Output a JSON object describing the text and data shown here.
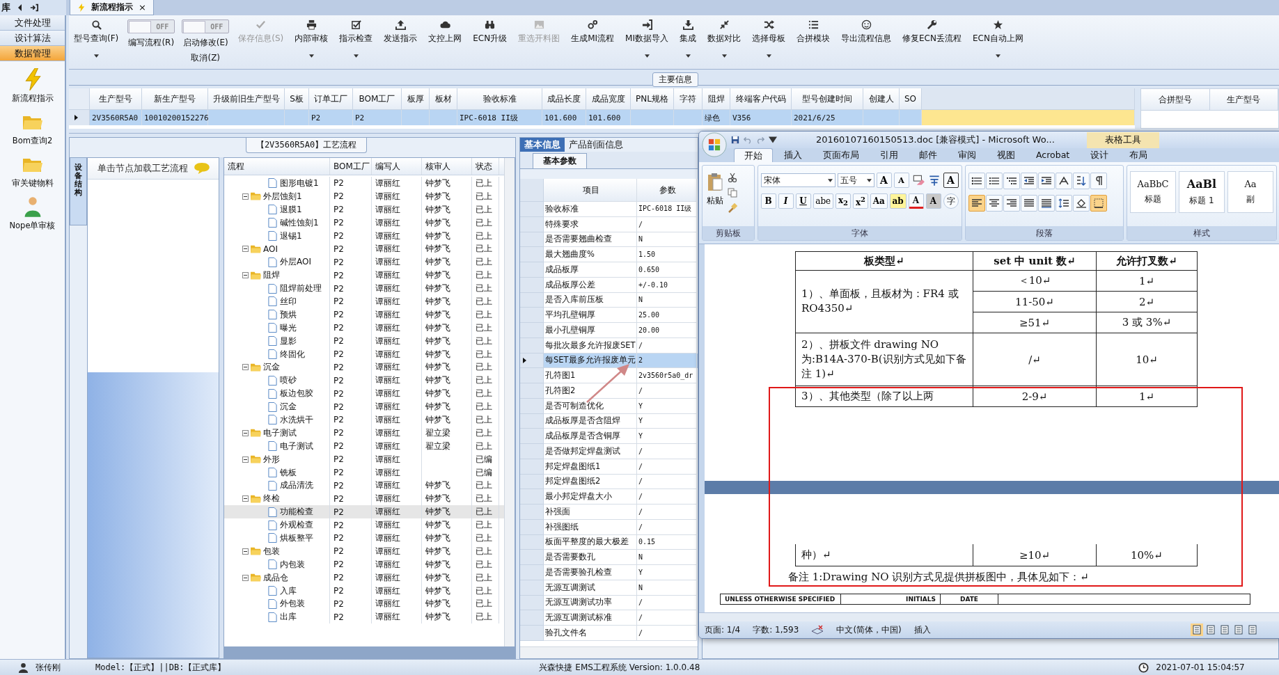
{
  "app_tabs": {
    "module_label": "库",
    "tab": {
      "title": "新流程指示",
      "close": "×"
    }
  },
  "sidebar": {
    "sections": [
      {
        "label": "文件处理",
        "selected": false
      },
      {
        "label": "设计算法",
        "selected": false
      },
      {
        "label": "数据管理",
        "selected": true
      }
    ],
    "items": [
      {
        "label": "新流程指示"
      },
      {
        "label": "Bom查询2"
      },
      {
        "label": "审关键物料"
      },
      {
        "label": "Nope单审核"
      }
    ]
  },
  "toolbar": [
    {
      "kind": "button",
      "label": "型号查询(F)",
      "dropdown": true,
      "disabled": false
    },
    {
      "kind": "toggle",
      "label": "编写流程(R)",
      "switch": "OFF",
      "on": false
    },
    {
      "kind": "toggle",
      "label": "启动修改(E)",
      "sublabel": "取消(Z)",
      "switch": "OFF",
      "on": false
    },
    {
      "kind": "button",
      "label": "保存信息(S)",
      "dropdown": false,
      "disabled": true
    },
    {
      "kind": "button",
      "label": "内部审核",
      "dropdown": true,
      "disabled": false
    },
    {
      "kind": "button",
      "label": "指示检查",
      "dropdown": true,
      "disabled": false
    },
    {
      "kind": "button",
      "label": "发送指示",
      "dropdown": false,
      "disabled": false
    },
    {
      "kind": "button",
      "label": "文控上网",
      "dropdown": false,
      "disabled": false
    },
    {
      "kind": "button",
      "label": "ECN升级",
      "dropdown": false,
      "disabled": false
    },
    {
      "kind": "button",
      "label": "重选开料图",
      "dropdown": false,
      "disabled": true
    },
    {
      "kind": "button",
      "label": "生成MI流程",
      "dropdown": false,
      "disabled": false
    },
    {
      "kind": "button",
      "label": "MI数据导入",
      "dropdown": true,
      "disabled": false
    },
    {
      "kind": "button",
      "label": "集成",
      "dropdown": true,
      "disabled": false
    },
    {
      "kind": "button",
      "label": "数据对比",
      "dropdown": true,
      "disabled": false
    },
    {
      "kind": "button",
      "label": "选择母板",
      "dropdown": true,
      "disabled": false
    },
    {
      "kind": "button",
      "label": "合拼模块",
      "dropdown": false,
      "disabled": false
    },
    {
      "kind": "button",
      "label": "导出流程信息",
      "dropdown": false,
      "disabled": false
    },
    {
      "kind": "button",
      "label": "修复ECN丢流程",
      "dropdown": false,
      "disabled": false
    },
    {
      "kind": "button",
      "label": "ECN自动上网",
      "dropdown": true,
      "disabled": false
    }
  ],
  "main_info": {
    "title": "主要信息",
    "columns": [
      "生产型号",
      "新生产型号",
      "升级前旧生产型号",
      "S板",
      "订单工厂",
      "BOM工厂",
      "板厚",
      "板材",
      "验收标准",
      "成品长度",
      "成品宽度",
      "PNL规格",
      "字符",
      "阻焊",
      "终端客户代码",
      "型号创建时间",
      "创建人",
      "SO"
    ],
    "rows": [
      {
        "selected": true,
        "cells": [
          "2V3560R5A0",
          "10010200152276",
          null,
          null,
          "P2",
          "P2",
          null,
          null,
          "IPC-6018 II级",
          "101.600",
          "101.600",
          null,
          null,
          "绿色",
          "V356",
          "2021/6/25",
          null,
          null
        ]
      }
    ],
    "merge_table": {
      "columns": [
        "合拼型号",
        "生产型号"
      ]
    }
  },
  "process_panel": {
    "title": "【2V3560R5A0】工艺流程",
    "side_tab": "设备结构",
    "hint": "单击节点加载工艺流程",
    "columns": [
      "流程",
      "BOM工厂",
      "编写人",
      "核审人",
      "状态"
    ],
    "tree": [
      {
        "kind": "file",
        "name": "图形电镀1",
        "bom": "P2",
        "writer": "谭丽红",
        "reviewer": "钟梦飞",
        "status": "已上",
        "selected": false
      },
      {
        "kind": "folder",
        "name": "外层蚀刻1",
        "expanded": true,
        "bom": "P2",
        "writer": "谭丽红",
        "reviewer": "钟梦飞",
        "status": "已上",
        "selected": false,
        "children": [
          {
            "kind": "file",
            "name": "退膜1",
            "bom": "P2",
            "writer": "谭丽红",
            "reviewer": "钟梦飞",
            "status": "已上",
            "selected": false
          },
          {
            "kind": "file",
            "name": "碱性蚀刻1",
            "bom": "P2",
            "writer": "谭丽红",
            "reviewer": "钟梦飞",
            "status": "已上",
            "selected": false
          },
          {
            "kind": "file",
            "name": "退锡1",
            "bom": "P2",
            "writer": "谭丽红",
            "reviewer": "钟梦飞",
            "status": "已上",
            "selected": false
          }
        ]
      },
      {
        "kind": "folder",
        "name": "AOI",
        "expanded": true,
        "bom": "P2",
        "writer": "谭丽红",
        "reviewer": "钟梦飞",
        "status": "已上",
        "selected": false,
        "children": [
          {
            "kind": "file",
            "name": "外层AOI",
            "bom": "P2",
            "writer": "谭丽红",
            "reviewer": "钟梦飞",
            "status": "已上",
            "selected": false
          }
        ]
      },
      {
        "kind": "folder",
        "name": "阻焊",
        "expanded": true,
        "bom": "P2",
        "writer": "谭丽红",
        "reviewer": "钟梦飞",
        "status": "已上",
        "selected": false,
        "children": [
          {
            "kind": "file",
            "name": "阻焊前处理",
            "bom": "P2",
            "writer": "谭丽红",
            "reviewer": "钟梦飞",
            "status": "已上",
            "selected": false
          },
          {
            "kind": "file",
            "name": "丝印",
            "bom": "P2",
            "writer": "谭丽红",
            "reviewer": "钟梦飞",
            "status": "已上",
            "selected": false
          },
          {
            "kind": "file",
            "name": "预烘",
            "bom": "P2",
            "writer": "谭丽红",
            "reviewer": "钟梦飞",
            "status": "已上",
            "selected": false
          },
          {
            "kind": "file",
            "name": "曝光",
            "bom": "P2",
            "writer": "谭丽红",
            "reviewer": "钟梦飞",
            "status": "已上",
            "selected": false
          },
          {
            "kind": "file",
            "name": "显影",
            "bom": "P2",
            "writer": "谭丽红",
            "reviewer": "钟梦飞",
            "status": "已上",
            "selected": false
          },
          {
            "kind": "file",
            "name": "终固化",
            "bom": "P2",
            "writer": "谭丽红",
            "reviewer": "钟梦飞",
            "status": "已上",
            "selected": false
          }
        ]
      },
      {
        "kind": "folder",
        "name": "沉金",
        "expanded": true,
        "bom": "P2",
        "writer": "谭丽红",
        "reviewer": "钟梦飞",
        "status": "已上",
        "selected": false,
        "children": [
          {
            "kind": "file",
            "name": "喷砂",
            "bom": "P2",
            "writer": "谭丽红",
            "reviewer": "钟梦飞",
            "status": "已上",
            "selected": false
          },
          {
            "kind": "file",
            "name": "板边包胶",
            "bom": "P2",
            "writer": "谭丽红",
            "reviewer": "钟梦飞",
            "status": "已上",
            "selected": false
          },
          {
            "kind": "file",
            "name": "沉金",
            "bom": "P2",
            "writer": "谭丽红",
            "reviewer": "钟梦飞",
            "status": "已上",
            "selected": false
          },
          {
            "kind": "file",
            "name": "水洗烘干",
            "bom": "P2",
            "writer": "谭丽红",
            "reviewer": "钟梦飞",
            "status": "已上",
            "selected": false
          }
        ]
      },
      {
        "kind": "folder",
        "name": "电子测试",
        "expanded": true,
        "bom": "P2",
        "writer": "谭丽红",
        "reviewer": "翟立梁",
        "status": "已上",
        "selected": false,
        "children": [
          {
            "kind": "file",
            "name": "电子测试",
            "bom": "P2",
            "writer": "谭丽红",
            "reviewer": "翟立梁",
            "status": "已上",
            "selected": false
          }
        ]
      },
      {
        "kind": "folder",
        "name": "外形",
        "expanded": true,
        "bom": "P2",
        "writer": "谭丽红",
        "status": "已编",
        "selected": false,
        "children": [
          {
            "kind": "file",
            "name": "铣板",
            "bom": "P2",
            "writer": "谭丽红",
            "status": "已编",
            "selected": false
          },
          {
            "kind": "file",
            "name": "成品清洗",
            "bom": "P2",
            "writer": "谭丽红",
            "reviewer": "钟梦飞",
            "status": "已上",
            "selected": false
          }
        ]
      },
      {
        "kind": "folder",
        "name": "终检",
        "expanded": true,
        "bom": "P2",
        "writer": "谭丽红",
        "reviewer": "钟梦飞",
        "status": "已上",
        "selected": false,
        "children": [
          {
            "kind": "file",
            "name": "功能检查",
            "bom": "P2",
            "writer": "谭丽红",
            "reviewer": "钟梦飞",
            "status": "已上",
            "selected": true
          },
          {
            "kind": "file",
            "name": "外观检查",
            "bom": "P2",
            "writer": "谭丽红",
            "reviewer": "钟梦飞",
            "status": "已上",
            "selected": false
          },
          {
            "kind": "file",
            "name": "烘板整平",
            "bom": "P2",
            "writer": "谭丽红",
            "reviewer": "钟梦飞",
            "status": "已上",
            "selected": false
          }
        ]
      },
      {
        "kind": "folder",
        "name": "包装",
        "expanded": true,
        "bom": "P2",
        "writer": "谭丽红",
        "reviewer": "钟梦飞",
        "status": "已上",
        "selected": false,
        "children": [
          {
            "kind": "file",
            "name": "内包装",
            "bom": "P2",
            "writer": "谭丽红",
            "reviewer": "钟梦飞",
            "status": "已上",
            "selected": false
          }
        ]
      },
      {
        "kind": "folder",
        "name": "成品仓",
        "expanded": true,
        "bom": "P2",
        "writer": "谭丽红",
        "reviewer": "钟梦飞",
        "status": "已上",
        "selected": false,
        "children": [
          {
            "kind": "file",
            "name": "入库",
            "bom": "P2",
            "writer": "谭丽红",
            "reviewer": "钟梦飞",
            "status": "已上",
            "selected": false
          },
          {
            "kind": "file",
            "name": "外包装",
            "bom": "P2",
            "writer": "谭丽红",
            "reviewer": "钟梦飞",
            "status": "已上",
            "selected": false
          },
          {
            "kind": "file",
            "name": "出库",
            "bom": "P2",
            "writer": "谭丽红",
            "reviewer": "钟梦飞",
            "status": "已上",
            "selected": false
          }
        ]
      }
    ]
  },
  "info_panel": {
    "tabs": [
      {
        "label": "基本信息",
        "selected": true
      },
      {
        "label": "产品剖面信息",
        "selected": false
      }
    ],
    "subtab": "基本参数",
    "columns": [
      "项目",
      "参数"
    ],
    "rows": [
      {
        "item": "验收标准",
        "value": "IPC-6018 II级",
        "selected": false
      },
      {
        "item": "特殊要求",
        "value": "/",
        "selected": false
      },
      {
        "item": "是否需要翘曲检查",
        "value": "N",
        "selected": false
      },
      {
        "item": "最大翘曲度%",
        "value": "1.50",
        "selected": false
      },
      {
        "item": "成品板厚",
        "value": "0.650",
        "selected": false
      },
      {
        "item": "成品板厚公差",
        "value": "+/-0.10",
        "selected": false
      },
      {
        "item": "是否入库前压板",
        "value": "N",
        "selected": false
      },
      {
        "item": "平均孔壁铜厚",
        "value": "25.00",
        "selected": false
      },
      {
        "item": "最小孔壁铜厚",
        "value": "20.00",
        "selected": false
      },
      {
        "item": "每批次最多允许报废SET",
        "value": "/",
        "selected": false
      },
      {
        "item": "每SET最多允许报废单元",
        "value": "2",
        "selected": true
      },
      {
        "item": "孔符图1",
        "value": "2v3560r5a0_dr",
        "selected": false
      },
      {
        "item": "孔符图2",
        "value": "/",
        "selected": false
      },
      {
        "item": "是否可制造优化",
        "value": "Y",
        "selected": false
      },
      {
        "item": "成品板厚是否含阻焊",
        "value": "Y",
        "selected": false
      },
      {
        "item": "成品板厚是否含铜厚",
        "value": "Y",
        "selected": false
      },
      {
        "item": "是否做邦定焊盘测试",
        "value": "/",
        "selected": false
      },
      {
        "item": "邦定焊盘图纸1",
        "value": "/",
        "selected": false
      },
      {
        "item": "邦定焊盘图纸2",
        "value": "/",
        "selected": false
      },
      {
        "item": "最小邦定焊盘大小",
        "value": "/",
        "selected": false
      },
      {
        "item": "补强面",
        "value": "/",
        "selected": false
      },
      {
        "item": "补强图纸",
        "value": "/",
        "selected": false
      },
      {
        "item": "板面平整度的最大极差",
        "value": "0.15",
        "selected": false
      },
      {
        "item": "是否需要数孔",
        "value": "N",
        "selected": false
      },
      {
        "item": "是否需要验孔检查",
        "value": "Y",
        "selected": false
      },
      {
        "item": "无源互调测试",
        "value": "N",
        "selected": false
      },
      {
        "item": "无源互调测试功率",
        "value": "/",
        "selected": false
      },
      {
        "item": "无源互调测试标准",
        "value": "/",
        "selected": false
      },
      {
        "item": "验孔文件名",
        "value": "/",
        "selected": false
      }
    ]
  },
  "word_window": {
    "title": "20160107160150513.doc [兼容模式] - Microsoft Wo...",
    "context_tab": "表格工具",
    "tabs": [
      {
        "label": "开始",
        "selected": true
      },
      {
        "label": "插入",
        "selected": false
      },
      {
        "label": "页面布局",
        "selected": false
      },
      {
        "label": "引用",
        "selected": false
      },
      {
        "label": "邮件",
        "selected": false
      },
      {
        "label": "审阅",
        "selected": false
      },
      {
        "label": "视图",
        "selected": false
      },
      {
        "label": "Acrobat",
        "selected": false
      },
      {
        "label": "设计",
        "selected": false
      },
      {
        "label": "布局",
        "selected": false
      }
    ],
    "clipboard": {
      "paste": "粘贴",
      "group": "剪贴板"
    },
    "font": {
      "name": "宋体",
      "size": "五号",
      "group": "字体",
      "row1": [
        {
          "kind": "grow",
          "text": "A"
        },
        {
          "kind": "shrink",
          "text": "A"
        },
        {
          "kind": "clear"
        },
        {
          "kind": "phonetic"
        },
        {
          "kind": "border",
          "text": "A"
        }
      ],
      "row2": [
        {
          "kind": "bold",
          "text": "B"
        },
        {
          "kind": "italic",
          "text": "I"
        },
        {
          "kind": "underline",
          "text": "U"
        },
        {
          "kind": "strike",
          "text": "abe"
        },
        {
          "kind": "sub",
          "text": "x$_{2}$"
        },
        {
          "kind": "sup",
          "text": "x$^{2}$"
        },
        {
          "kind": "case",
          "text": "Aa"
        },
        {
          "kind": "highlight",
          "text": "ab"
        },
        {
          "kind": "color",
          "text": "A"
        },
        {
          "kind": "shade",
          "text": "A"
        },
        {
          "kind": "enclose",
          "text": "字"
        }
      ]
    },
    "paragraph": {
      "group": "段落",
      "row2": [
        {
          "kind": "left",
          "selected": true
        },
        {
          "kind": "center",
          "selected": false
        },
        {
          "kind": "right",
          "selected": false
        },
        {
          "kind": "justify",
          "selected": false
        },
        {
          "kind": "distributed",
          "selected": false
        },
        {
          "kind": "spacing",
          "selected": false
        },
        {
          "kind": "shading",
          "selected": false
        },
        {
          "kind": "borders",
          "selected": true
        }
      ]
    },
    "styles": {
      "group": "样式",
      "items": [
        {
          "sample": "AaBbC",
          "name": "标题"
        },
        {
          "sample": "AaBl",
          "name": "标题 1"
        },
        {
          "sample": "Aa",
          "name": "副"
        }
      ]
    },
    "document": {
      "header": [
        "板类型↵",
        "set 中 unit 数↵",
        "允许打叉数↵"
      ],
      "groups": [
        {
          "type": "1）、单面板，且板材为：FR4 或 RO4350↵",
          "rows": [
            [
              "＜10↵",
              "1↵"
            ],
            [
              "11-50↵",
              "2↵"
            ],
            [
              "≥51↵",
              "3 或 3%↵"
            ]
          ]
        },
        {
          "type": "2）、拼板文件 drawing NO 为:B14A-370-B(识别方式见如下备注 1)↵",
          "rows": [
            [
              "/↵",
              "10↵"
            ]
          ]
        },
        {
          "type": "3）、其他类型（除了以上两",
          "rows": [
            [
              "2-9↵",
              "1↵"
            ]
          ]
        }
      ],
      "continued_row": [
        "种）↵",
        "≥10↵",
        "10%↵"
      ],
      "note": "备注 1:Drawing NO 识别方式见提供拼板图中，具体见如下：↵",
      "footer_table": [
        "UNLESS OTHERWISE SPECIFIED",
        "INITIALS",
        "DATE"
      ]
    },
    "status": {
      "page": "页面: 1/4",
      "words": "字数: 1,593",
      "language": "中文(简体，中国)",
      "mode": "插入",
      "views": [
        {
          "selected": true
        },
        {
          "selected": false
        },
        {
          "selected": false
        },
        {
          "selected": false
        },
        {
          "selected": false
        }
      ]
    }
  },
  "status_bar": {
    "user": "张传刚",
    "environment": "Model:【正式】||DB:【正式库】",
    "product": "兴森快捷 EMS工程系统 Version: 1.0.0.48",
    "time": "2021-07-01 15:04:57"
  }
}
